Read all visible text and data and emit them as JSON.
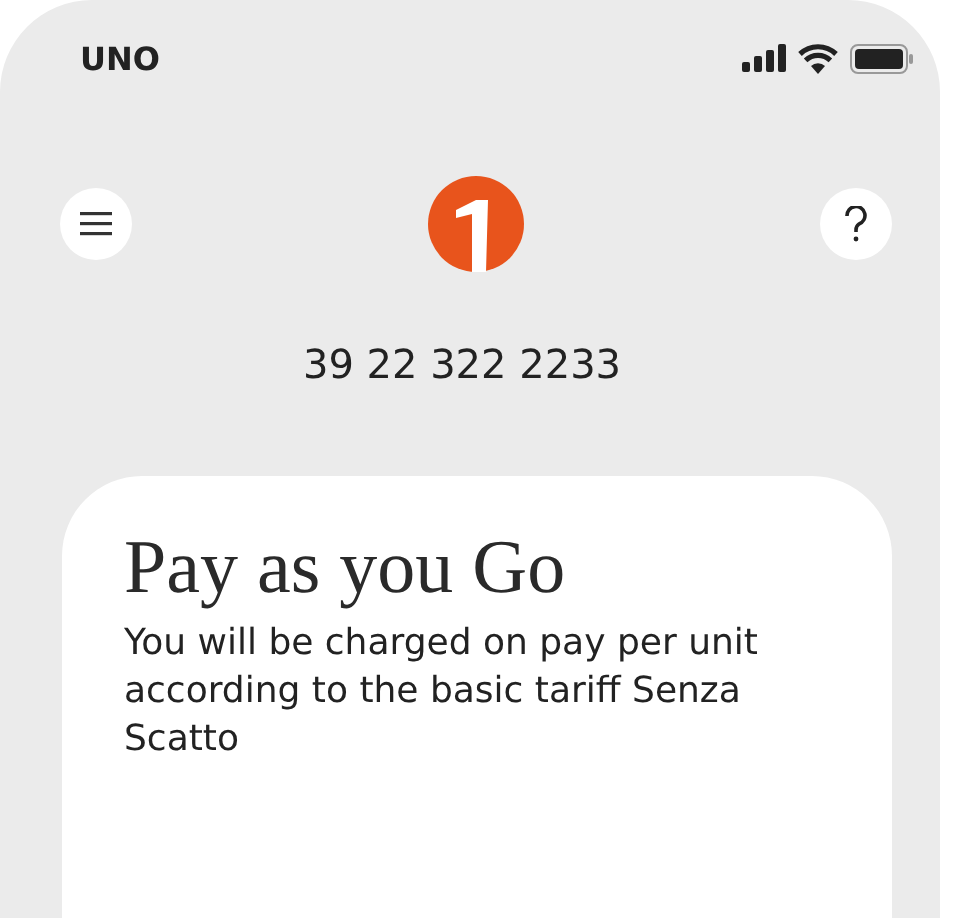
{
  "status_bar": {
    "carrier": "UNO"
  },
  "header": {
    "phone_number": "39 22 322 2233"
  },
  "card": {
    "title": "Pay as you Go",
    "description": "You will be charged on pay per unit according to the basic tariff Senza Scatto"
  }
}
